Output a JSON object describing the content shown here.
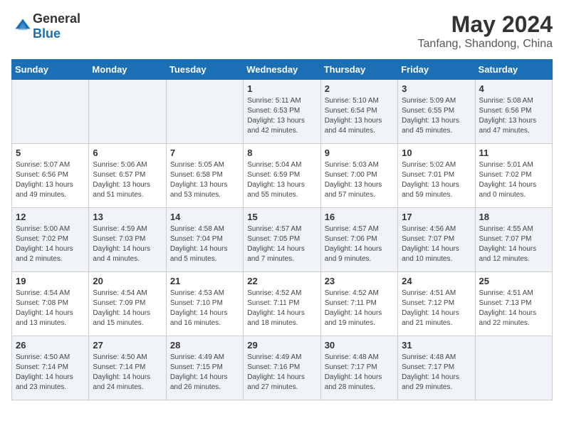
{
  "header": {
    "logo_general": "General",
    "logo_blue": "Blue",
    "month_year": "May 2024",
    "location": "Tanfang, Shandong, China"
  },
  "days_of_week": [
    "Sunday",
    "Monday",
    "Tuesday",
    "Wednesday",
    "Thursday",
    "Friday",
    "Saturday"
  ],
  "weeks": [
    [
      {
        "day": "",
        "sunrise": "",
        "sunset": "",
        "daylight": ""
      },
      {
        "day": "",
        "sunrise": "",
        "sunset": "",
        "daylight": ""
      },
      {
        "day": "",
        "sunrise": "",
        "sunset": "",
        "daylight": ""
      },
      {
        "day": "1",
        "sunrise": "Sunrise: 5:11 AM",
        "sunset": "Sunset: 6:53 PM",
        "daylight": "Daylight: 13 hours and 42 minutes."
      },
      {
        "day": "2",
        "sunrise": "Sunrise: 5:10 AM",
        "sunset": "Sunset: 6:54 PM",
        "daylight": "Daylight: 13 hours and 44 minutes."
      },
      {
        "day": "3",
        "sunrise": "Sunrise: 5:09 AM",
        "sunset": "Sunset: 6:55 PM",
        "daylight": "Daylight: 13 hours and 45 minutes."
      },
      {
        "day": "4",
        "sunrise": "Sunrise: 5:08 AM",
        "sunset": "Sunset: 6:56 PM",
        "daylight": "Daylight: 13 hours and 47 minutes."
      }
    ],
    [
      {
        "day": "5",
        "sunrise": "Sunrise: 5:07 AM",
        "sunset": "Sunset: 6:56 PM",
        "daylight": "Daylight: 13 hours and 49 minutes."
      },
      {
        "day": "6",
        "sunrise": "Sunrise: 5:06 AM",
        "sunset": "Sunset: 6:57 PM",
        "daylight": "Daylight: 13 hours and 51 minutes."
      },
      {
        "day": "7",
        "sunrise": "Sunrise: 5:05 AM",
        "sunset": "Sunset: 6:58 PM",
        "daylight": "Daylight: 13 hours and 53 minutes."
      },
      {
        "day": "8",
        "sunrise": "Sunrise: 5:04 AM",
        "sunset": "Sunset: 6:59 PM",
        "daylight": "Daylight: 13 hours and 55 minutes."
      },
      {
        "day": "9",
        "sunrise": "Sunrise: 5:03 AM",
        "sunset": "Sunset: 7:00 PM",
        "daylight": "Daylight: 13 hours and 57 minutes."
      },
      {
        "day": "10",
        "sunrise": "Sunrise: 5:02 AM",
        "sunset": "Sunset: 7:01 PM",
        "daylight": "Daylight: 13 hours and 59 minutes."
      },
      {
        "day": "11",
        "sunrise": "Sunrise: 5:01 AM",
        "sunset": "Sunset: 7:02 PM",
        "daylight": "Daylight: 14 hours and 0 minutes."
      }
    ],
    [
      {
        "day": "12",
        "sunrise": "Sunrise: 5:00 AM",
        "sunset": "Sunset: 7:02 PM",
        "daylight": "Daylight: 14 hours and 2 minutes."
      },
      {
        "day": "13",
        "sunrise": "Sunrise: 4:59 AM",
        "sunset": "Sunset: 7:03 PM",
        "daylight": "Daylight: 14 hours and 4 minutes."
      },
      {
        "day": "14",
        "sunrise": "Sunrise: 4:58 AM",
        "sunset": "Sunset: 7:04 PM",
        "daylight": "Daylight: 14 hours and 5 minutes."
      },
      {
        "day": "15",
        "sunrise": "Sunrise: 4:57 AM",
        "sunset": "Sunset: 7:05 PM",
        "daylight": "Daylight: 14 hours and 7 minutes."
      },
      {
        "day": "16",
        "sunrise": "Sunrise: 4:57 AM",
        "sunset": "Sunset: 7:06 PM",
        "daylight": "Daylight: 14 hours and 9 minutes."
      },
      {
        "day": "17",
        "sunrise": "Sunrise: 4:56 AM",
        "sunset": "Sunset: 7:07 PM",
        "daylight": "Daylight: 14 hours and 10 minutes."
      },
      {
        "day": "18",
        "sunrise": "Sunrise: 4:55 AM",
        "sunset": "Sunset: 7:07 PM",
        "daylight": "Daylight: 14 hours and 12 minutes."
      }
    ],
    [
      {
        "day": "19",
        "sunrise": "Sunrise: 4:54 AM",
        "sunset": "Sunset: 7:08 PM",
        "daylight": "Daylight: 14 hours and 13 minutes."
      },
      {
        "day": "20",
        "sunrise": "Sunrise: 4:54 AM",
        "sunset": "Sunset: 7:09 PM",
        "daylight": "Daylight: 14 hours and 15 minutes."
      },
      {
        "day": "21",
        "sunrise": "Sunrise: 4:53 AM",
        "sunset": "Sunset: 7:10 PM",
        "daylight": "Daylight: 14 hours and 16 minutes."
      },
      {
        "day": "22",
        "sunrise": "Sunrise: 4:52 AM",
        "sunset": "Sunset: 7:11 PM",
        "daylight": "Daylight: 14 hours and 18 minutes."
      },
      {
        "day": "23",
        "sunrise": "Sunrise: 4:52 AM",
        "sunset": "Sunset: 7:11 PM",
        "daylight": "Daylight: 14 hours and 19 minutes."
      },
      {
        "day": "24",
        "sunrise": "Sunrise: 4:51 AM",
        "sunset": "Sunset: 7:12 PM",
        "daylight": "Daylight: 14 hours and 21 minutes."
      },
      {
        "day": "25",
        "sunrise": "Sunrise: 4:51 AM",
        "sunset": "Sunset: 7:13 PM",
        "daylight": "Daylight: 14 hours and 22 minutes."
      }
    ],
    [
      {
        "day": "26",
        "sunrise": "Sunrise: 4:50 AM",
        "sunset": "Sunset: 7:14 PM",
        "daylight": "Daylight: 14 hours and 23 minutes."
      },
      {
        "day": "27",
        "sunrise": "Sunrise: 4:50 AM",
        "sunset": "Sunset: 7:14 PM",
        "daylight": "Daylight: 14 hours and 24 minutes."
      },
      {
        "day": "28",
        "sunrise": "Sunrise: 4:49 AM",
        "sunset": "Sunset: 7:15 PM",
        "daylight": "Daylight: 14 hours and 26 minutes."
      },
      {
        "day": "29",
        "sunrise": "Sunrise: 4:49 AM",
        "sunset": "Sunset: 7:16 PM",
        "daylight": "Daylight: 14 hours and 27 minutes."
      },
      {
        "day": "30",
        "sunrise": "Sunrise: 4:48 AM",
        "sunset": "Sunset: 7:17 PM",
        "daylight": "Daylight: 14 hours and 28 minutes."
      },
      {
        "day": "31",
        "sunrise": "Sunrise: 4:48 AM",
        "sunset": "Sunset: 7:17 PM",
        "daylight": "Daylight: 14 hours and 29 minutes."
      },
      {
        "day": "",
        "sunrise": "",
        "sunset": "",
        "daylight": ""
      }
    ]
  ]
}
